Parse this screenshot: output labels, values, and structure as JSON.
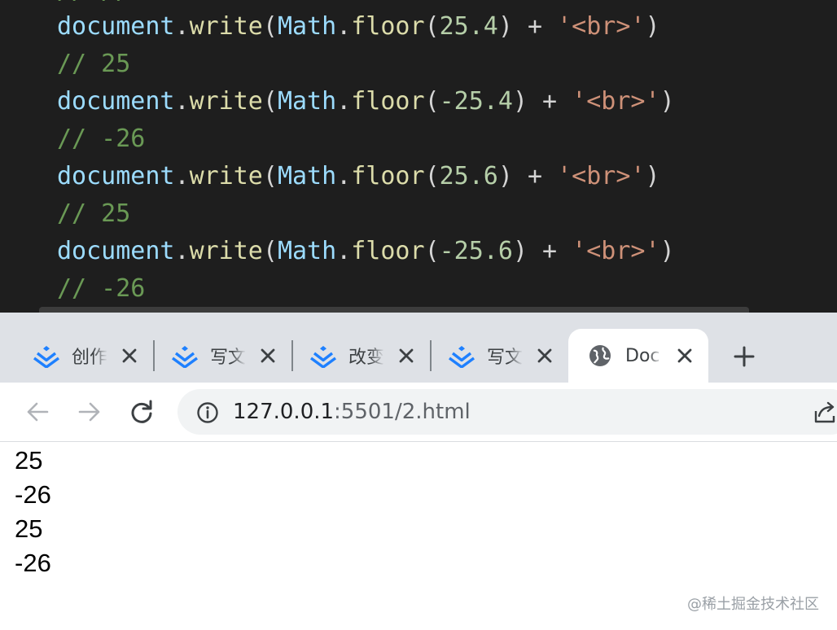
{
  "editor": {
    "partial_top": "// //",
    "lines": [
      {
        "kind": "code",
        "tokens": [
          {
            "t": "document",
            "c": "tok-var"
          },
          {
            "t": ".",
            "c": "tok-punc"
          },
          {
            "t": "write",
            "c": "tok-fn"
          },
          {
            "t": "(",
            "c": "tok-punc"
          },
          {
            "t": "Math",
            "c": "tok-var"
          },
          {
            "t": ".",
            "c": "tok-punc"
          },
          {
            "t": "floor",
            "c": "tok-fn"
          },
          {
            "t": "(",
            "c": "tok-punc"
          },
          {
            "t": "25.4",
            "c": "tok-num"
          },
          {
            "t": ") + ",
            "c": "tok-op"
          },
          {
            "t": "'<br>'",
            "c": "tok-str"
          },
          {
            "t": ")",
            "c": "tok-punc"
          }
        ]
      },
      {
        "kind": "comment",
        "text": "// 25"
      },
      {
        "kind": "code",
        "tokens": [
          {
            "t": "document",
            "c": "tok-var"
          },
          {
            "t": ".",
            "c": "tok-punc"
          },
          {
            "t": "write",
            "c": "tok-fn"
          },
          {
            "t": "(",
            "c": "tok-punc"
          },
          {
            "t": "Math",
            "c": "tok-var"
          },
          {
            "t": ".",
            "c": "tok-punc"
          },
          {
            "t": "floor",
            "c": "tok-fn"
          },
          {
            "t": "(",
            "c": "tok-punc"
          },
          {
            "t": "-25.4",
            "c": "tok-num"
          },
          {
            "t": ") + ",
            "c": "tok-op"
          },
          {
            "t": "'<br>'",
            "c": "tok-str"
          },
          {
            "t": ")",
            "c": "tok-punc"
          }
        ]
      },
      {
        "kind": "comment",
        "text": "// -26"
      },
      {
        "kind": "code",
        "tokens": [
          {
            "t": "document",
            "c": "tok-var"
          },
          {
            "t": ".",
            "c": "tok-punc"
          },
          {
            "t": "write",
            "c": "tok-fn"
          },
          {
            "t": "(",
            "c": "tok-punc"
          },
          {
            "t": "Math",
            "c": "tok-var"
          },
          {
            "t": ".",
            "c": "tok-punc"
          },
          {
            "t": "floor",
            "c": "tok-fn"
          },
          {
            "t": "(",
            "c": "tok-punc"
          },
          {
            "t": "25.6",
            "c": "tok-num"
          },
          {
            "t": ") + ",
            "c": "tok-op"
          },
          {
            "t": "'<br>'",
            "c": "tok-str"
          },
          {
            "t": ")",
            "c": "tok-punc"
          }
        ]
      },
      {
        "kind": "comment",
        "text": "// 25"
      },
      {
        "kind": "code",
        "tokens": [
          {
            "t": "document",
            "c": "tok-var"
          },
          {
            "t": ".",
            "c": "tok-punc"
          },
          {
            "t": "write",
            "c": "tok-fn"
          },
          {
            "t": "(",
            "c": "tok-punc"
          },
          {
            "t": "Math",
            "c": "tok-var"
          },
          {
            "t": ".",
            "c": "tok-punc"
          },
          {
            "t": "floor",
            "c": "tok-fn"
          },
          {
            "t": "(",
            "c": "tok-punc"
          },
          {
            "t": "-25.6",
            "c": "tok-num"
          },
          {
            "t": ") + ",
            "c": "tok-op"
          },
          {
            "t": "'<br>'",
            "c": "tok-str"
          },
          {
            "t": ")",
            "c": "tok-punc"
          }
        ]
      },
      {
        "kind": "comment",
        "text": "// -26"
      }
    ]
  },
  "browser": {
    "tabs": [
      {
        "title": "创作",
        "icon": "juejin-logo-icon",
        "active": false
      },
      {
        "title": "写文",
        "icon": "juejin-logo-icon",
        "active": false
      },
      {
        "title": "改变",
        "icon": "juejin-logo-icon",
        "active": false
      },
      {
        "title": "写文",
        "icon": "juejin-logo-icon",
        "active": false
      },
      {
        "title": "Doc",
        "icon": "globe-icon",
        "active": true
      }
    ],
    "url_host": "127.0.0.1",
    "url_rest": ":5501/2.html",
    "page_output": [
      "25",
      "-26",
      "25",
      "-26"
    ],
    "colors": {
      "tabstrip": "#dee1e6",
      "juejin_blue": "#1e80ff"
    }
  },
  "watermark": "@稀土掘金技术社区"
}
